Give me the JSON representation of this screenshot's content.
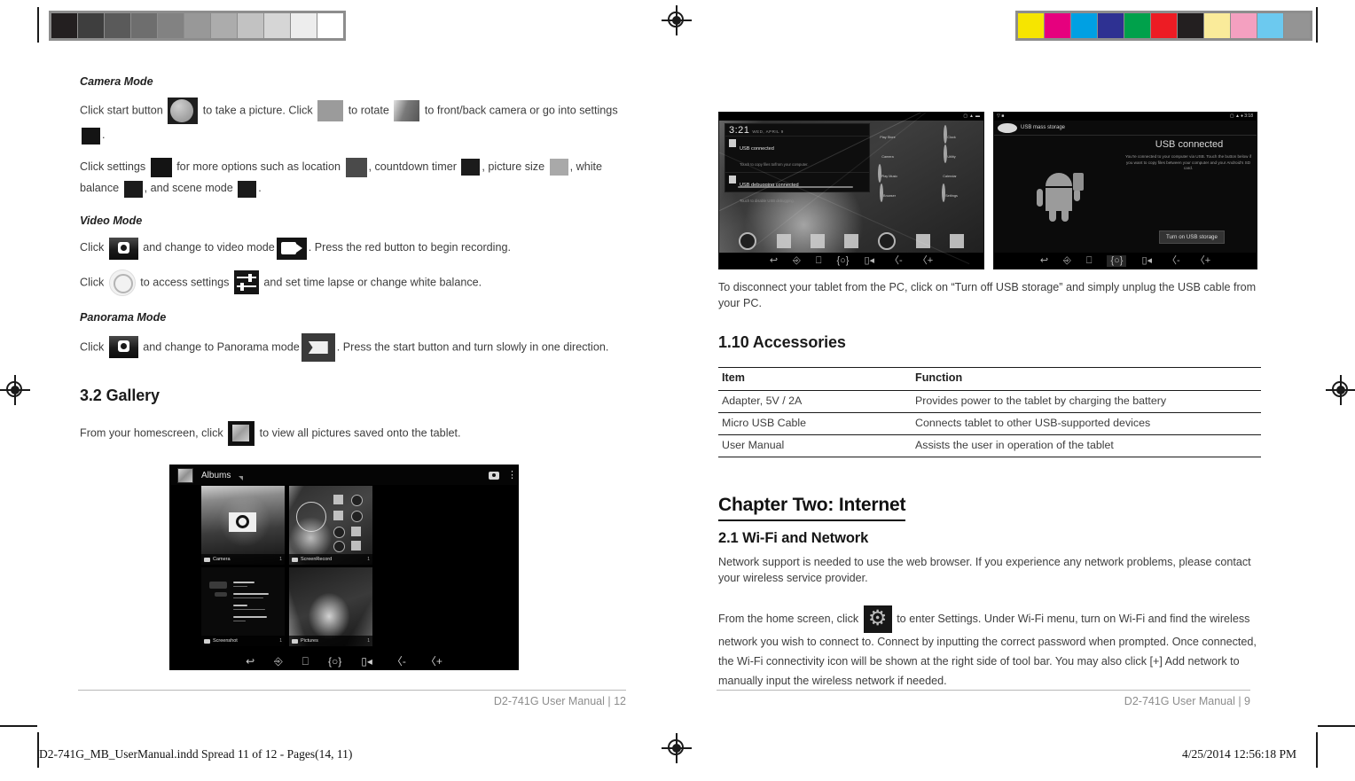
{
  "document": {
    "title": "D2-741G User Manual",
    "spread_note": "D2-741G_MB_UserManual.indd   Spread 11 of 12 - Pages(14, 11)",
    "print_timestamp": "4/25/2014   12:56:18 PM"
  },
  "left_page": {
    "footer": "D2-741G User Manual | 12",
    "camera_mode": {
      "heading": "Camera Mode",
      "p1_a": "Click start button",
      "p1_b": "to take a picture. Click",
      "p1_c": "to rotate",
      "p1_d": "to front/back camera or go into settings",
      "p1_e": ".",
      "p2_a": "Click settings",
      "p2_b": "for more options such as location",
      "p2_c": ", countdown timer",
      "p2_d": ", picture size",
      "p2_e": ", white balance",
      "p2_f": ", and scene mode",
      "p2_g": "."
    },
    "video_mode": {
      "heading": "Video Mode",
      "p1_a": "Click",
      "p1_b": "and change to video mode",
      "p1_c": ". Press the red button to begin recording.",
      "p2_a": "Click",
      "p2_b": "to access settings",
      "p2_c": "and set time lapse or change white balance."
    },
    "panorama_mode": {
      "heading": "Panorama Mode",
      "p1_a": "Click",
      "p1_b": "and change to Panorama mode",
      "p1_c": ". Press the start button and turn slowly in one direction."
    },
    "gallery": {
      "heading": "3.2 Gallery",
      "p1_a": "From your homescreen, click",
      "p1_b": "to view all pictures saved onto the tablet."
    },
    "gallery_screenshot": {
      "app_title": "Albums",
      "albums": [
        {
          "name": "Camera",
          "count": "1"
        },
        {
          "name": "ScreenRecord",
          "count": "1"
        },
        {
          "name": "Screenshot",
          "count": "1"
        },
        {
          "name": "Pictures",
          "count": "1"
        }
      ],
      "nav": [
        "back",
        "home",
        "recents",
        "screenshot",
        "screenrecord",
        "volume-down",
        "volume-up"
      ]
    }
  },
  "right_page": {
    "footer": "D2-741G User Manual | 9",
    "usb_home_screenshot": {
      "clock": "3:21",
      "date": "WED, APRIL 9",
      "notifications": [
        {
          "title": "USB connected",
          "subtitle": "Touch to copy files to/from your computer."
        },
        {
          "title": "USB debugging connected",
          "subtitle": "Touch to disable USB debugging."
        }
      ],
      "apps": [
        {
          "name": "Play Store"
        },
        {
          "name": "Camera"
        },
        {
          "name": "Play Music"
        },
        {
          "name": "Browser"
        },
        {
          "name": "Clock"
        },
        {
          "name": "Utility"
        },
        {
          "name": "Calendar"
        },
        {
          "name": "Settings"
        }
      ]
    },
    "usb_storage_screenshot": {
      "app_label": "USB mass storage",
      "status_time": "3:18",
      "heading": "USB connected",
      "body": "You're connected to your computer via USB. Touch the button below if you want to copy files between your computer and your Android's SD card.",
      "button": "Turn on USB storage"
    },
    "disconnect_paragraph": "To disconnect your tablet from the PC, click on “Turn off USB storage” and simply unplug the USB cable from your PC.",
    "accessories": {
      "heading": "1.10 Accessories",
      "columns": [
        "Item",
        "Function"
      ],
      "rows": [
        [
          "Adapter, 5V / 2A",
          "Provides power to the tablet by charging the battery"
        ],
        [
          "Micro USB Cable",
          "Connects tablet to other USB-supported devices"
        ],
        [
          "User Manual",
          "Assists the user in operation of the tablet"
        ]
      ]
    },
    "chapter": {
      "title": "Chapter Two: Internet",
      "section_title": "2.1 Wi-Fi and Network",
      "p1": "Network support is needed to use the web browser. If you experience any network problems, please contact your wireless service provider.",
      "p2_a": "From the home screen, click",
      "p2_b": "to enter Settings. Under Wi-Fi menu, turn on Wi-Fi and find the wireless network you wish to connect to. Connect by inputting the correct password when prompted. Once connected, the Wi-Fi connectivity icon will be shown at the right side of tool bar. You may also click [+] Add network to manually input the wireless network if needed."
    }
  },
  "print_marks": {
    "grayscale_bar": [
      "#231f20",
      "#3e3e3e",
      "#5a5a5a",
      "#6e6e6e",
      "#828282",
      "#989898",
      "#acacac",
      "#c2c2c2",
      "#d6d6d6",
      "#ededed",
      "#ffffff"
    ],
    "color_bar": [
      "#f6e500",
      "#e6007e",
      "#00a0e3",
      "#2e3192",
      "#00a14b",
      "#ed1c24",
      "#231f20",
      "#faeb9a",
      "#f4a0c0",
      "#6cc9ef",
      "#949494"
    ]
  }
}
